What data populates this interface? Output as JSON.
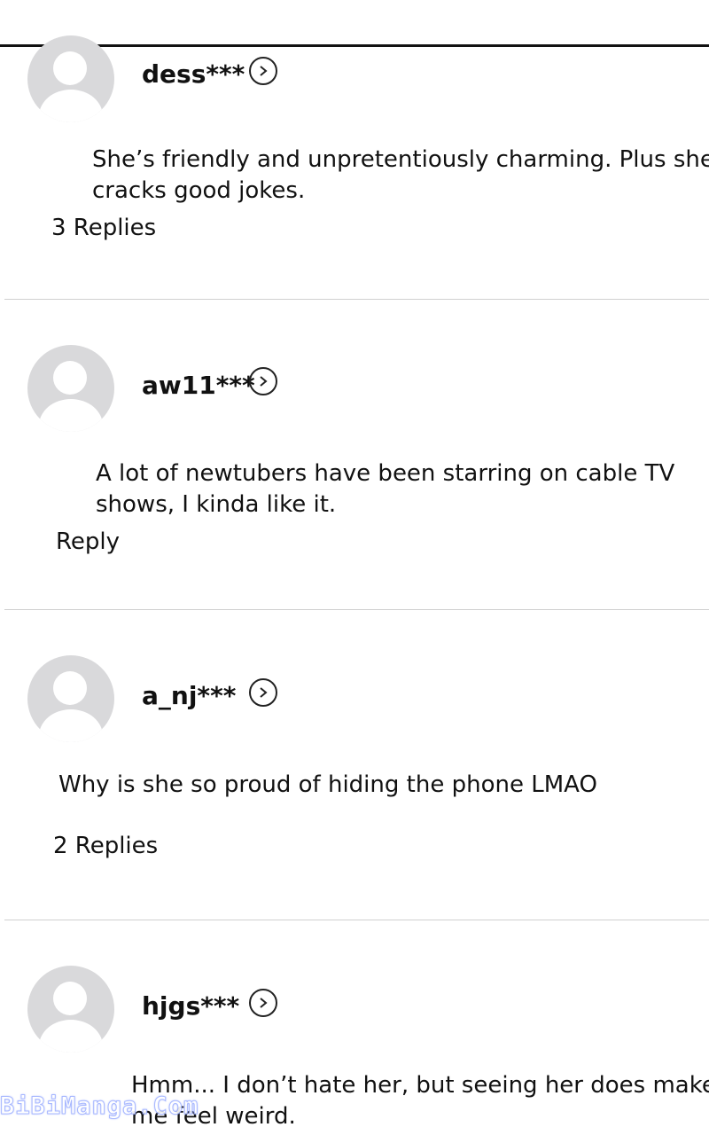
{
  "comments": [
    {
      "username": "dess***",
      "text_lines": [
        "She’s friendly and unpretentiously charming. Plus she",
        "cracks good jokes."
      ],
      "replies": "3 Replies"
    },
    {
      "username": "aw11***",
      "text_lines": [
        "A lot of newtubers have been starring on cable TV",
        "shows, I kinda like it."
      ],
      "replies": "Reply"
    },
    {
      "username": "a_nj***",
      "text_lines": [
        "Why is she so proud of hiding the phone LMAO"
      ],
      "replies": "2 Replies"
    },
    {
      "username": "hjgs***",
      "text_lines": [
        "Hmm... I don’t hate her, but seeing her does make",
        "me feel weird."
      ],
      "replies": ""
    }
  ],
  "icons": {
    "avatar": "default-avatar-icon",
    "profile_link": "chevron-right-circle-icon"
  },
  "watermark": "BiBiManga.Com",
  "colors": {
    "avatar": "#d9d9db",
    "divider": "#d0d0d0",
    "text": "#111111"
  }
}
